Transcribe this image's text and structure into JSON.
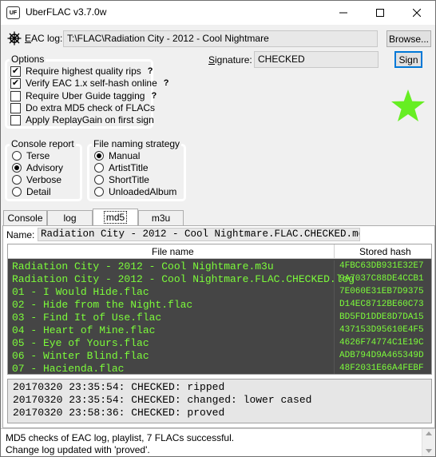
{
  "window": {
    "title": "UberFLAC v3.7.0w",
    "app_icon": "UF"
  },
  "header": {
    "eac_log_label": "EAC log:",
    "eac_log_path": "T:\\FLAC\\Radiation City - 2012 - Cool Nightmare",
    "browse_label": "Browse...",
    "signature_label": "Signature:",
    "signature_value": "CHECKED",
    "sign_label": "Sign"
  },
  "options": {
    "title": "Options",
    "items": [
      {
        "label": "Require highest quality rips",
        "checked": true,
        "help": "?"
      },
      {
        "label": "Verify EAC 1.x self-hash online",
        "checked": true,
        "help": "?"
      },
      {
        "label": "Require Uber Guide tagging",
        "checked": false,
        "help": "?"
      },
      {
        "label": "Do extra MD5 check of FLACs",
        "checked": false
      },
      {
        "label": "Apply ReplayGain on first sign",
        "checked": false
      }
    ]
  },
  "status_star": {
    "icon": "star-icon",
    "color": "#66ee22"
  },
  "console_report": {
    "title": "Console report",
    "options": [
      "Terse",
      "Advisory",
      "Verbose",
      "Detail"
    ],
    "selected": "Advisory"
  },
  "naming_strategy": {
    "title": "File naming strategy",
    "options": [
      "Manual",
      "ArtistTitle",
      "ShortTitle",
      "UnloadedAlbum"
    ],
    "selected": "Manual"
  },
  "tabs": [
    "Console",
    "log",
    "md5",
    "m3u"
  ],
  "active_tab": "md5",
  "md5_panel": {
    "name_label": "Name:",
    "name_value": "Radiation City - 2012 - Cool Nightmare.FLAC.CHECKED.md5",
    "columns": [
      "File name",
      "Stored hash"
    ],
    "rows": [
      {
        "file": "Radiation City - 2012 - Cool Nightmare.m3u",
        "hash": "4FBC63DB931E32E7"
      },
      {
        "file": "Radiation City - 2012 - Cool Nightmare.FLAC.CHECKED.log",
        "hash": "9A7037C88DE4CCB1"
      },
      {
        "file": "01 - I Would Hide.flac",
        "hash": "7E060E31EB7D9375"
      },
      {
        "file": "02 - Hide from the Night.flac",
        "hash": "D14EC8712BE60C73"
      },
      {
        "file": "03 - Find It of Use.flac",
        "hash": "BD5FD1DDE8D7DA15"
      },
      {
        "file": "04 - Heart of Mine.flac",
        "hash": "437153D95610E4F5"
      },
      {
        "file": "05 - Eye of Yours.flac",
        "hash": "4626F74774C1E19C"
      },
      {
        "file": "06 - Winter Blind.flac",
        "hash": "ADB794D9A465349D"
      },
      {
        "file": "07 - Hacienda.flac",
        "hash": "48F2031E66A4FEBF"
      }
    ],
    "log": [
      "20170320 23:35:54: CHECKED: ripped",
      "20170320 23:35:54: CHECKED: changed: lower cased",
      "20170320 23:58:36: CHECKED: proved"
    ]
  },
  "status": {
    "lines": [
      "MD5 checks of EAC log, playlist, 7 FLACs successful.",
      "Change log updated with 'proved'."
    ]
  }
}
